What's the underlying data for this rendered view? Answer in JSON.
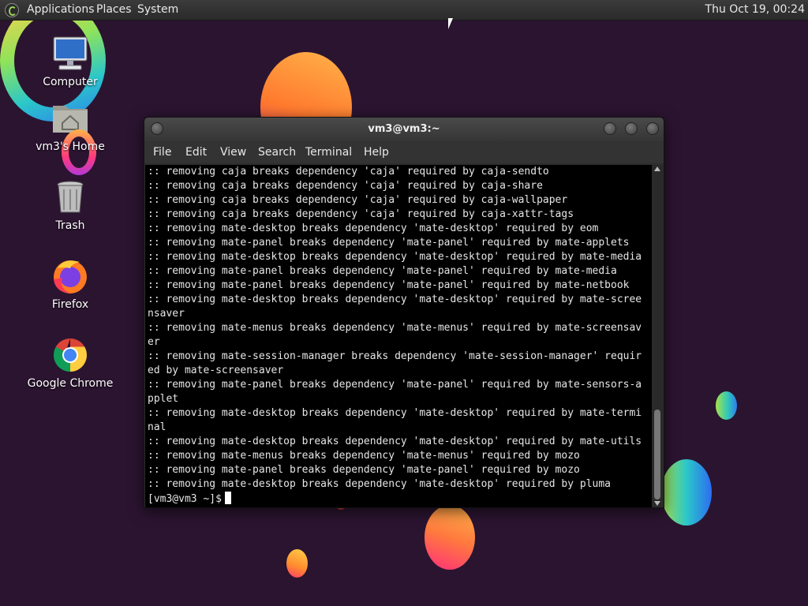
{
  "panel": {
    "menus": [
      "Applications",
      "Places",
      "System"
    ],
    "clock": "Thu Oct 19, 00:24"
  },
  "desktop": {
    "icons": [
      {
        "label": "Computer",
        "icon": "computer-icon"
      },
      {
        "label": "vm3's Home",
        "icon": "home-folder-icon"
      },
      {
        "label": "Trash",
        "icon": "trash-icon"
      },
      {
        "label": "Firefox",
        "icon": "firefox-icon"
      },
      {
        "label": "Google Chrome",
        "icon": "chrome-icon"
      }
    ]
  },
  "terminal": {
    "title": "vm3@vm3:~",
    "menu": [
      "File",
      "Edit",
      "View",
      "Search",
      "Terminal",
      "Help"
    ],
    "lines": [
      ":: removing caja breaks dependency 'caja' required by caja-sendto",
      ":: removing caja breaks dependency 'caja' required by caja-share",
      ":: removing caja breaks dependency 'caja' required by caja-wallpaper",
      ":: removing caja breaks dependency 'caja' required by caja-xattr-tags",
      ":: removing mate-desktop breaks dependency 'mate-desktop' required by eom",
      ":: removing mate-panel breaks dependency 'mate-panel' required by mate-applets",
      ":: removing mate-desktop breaks dependency 'mate-desktop' required by mate-media",
      ":: removing mate-panel breaks dependency 'mate-panel' required by mate-media",
      ":: removing mate-panel breaks dependency 'mate-panel' required by mate-netbook",
      ":: removing mate-desktop breaks dependency 'mate-desktop' required by mate-scree",
      "nsaver",
      ":: removing mate-menus breaks dependency 'mate-menus' required by mate-screensav",
      "er",
      ":: removing mate-session-manager breaks dependency 'mate-session-manager' requir",
      "ed by mate-screensaver",
      ":: removing mate-panel breaks dependency 'mate-panel' required by mate-sensors-a",
      "pplet",
      ":: removing mate-desktop breaks dependency 'mate-desktop' required by mate-termi",
      "nal",
      ":: removing mate-desktop breaks dependency 'mate-desktop' required by mate-utils",
      ":: removing mate-menus breaks dependency 'mate-menus' required by mozo",
      ":: removing mate-panel breaks dependency 'mate-panel' required by mozo",
      ":: removing mate-desktop breaks dependency 'mate-desktop' required by pluma"
    ],
    "prompt": "[vm3@vm3 ~]$"
  }
}
